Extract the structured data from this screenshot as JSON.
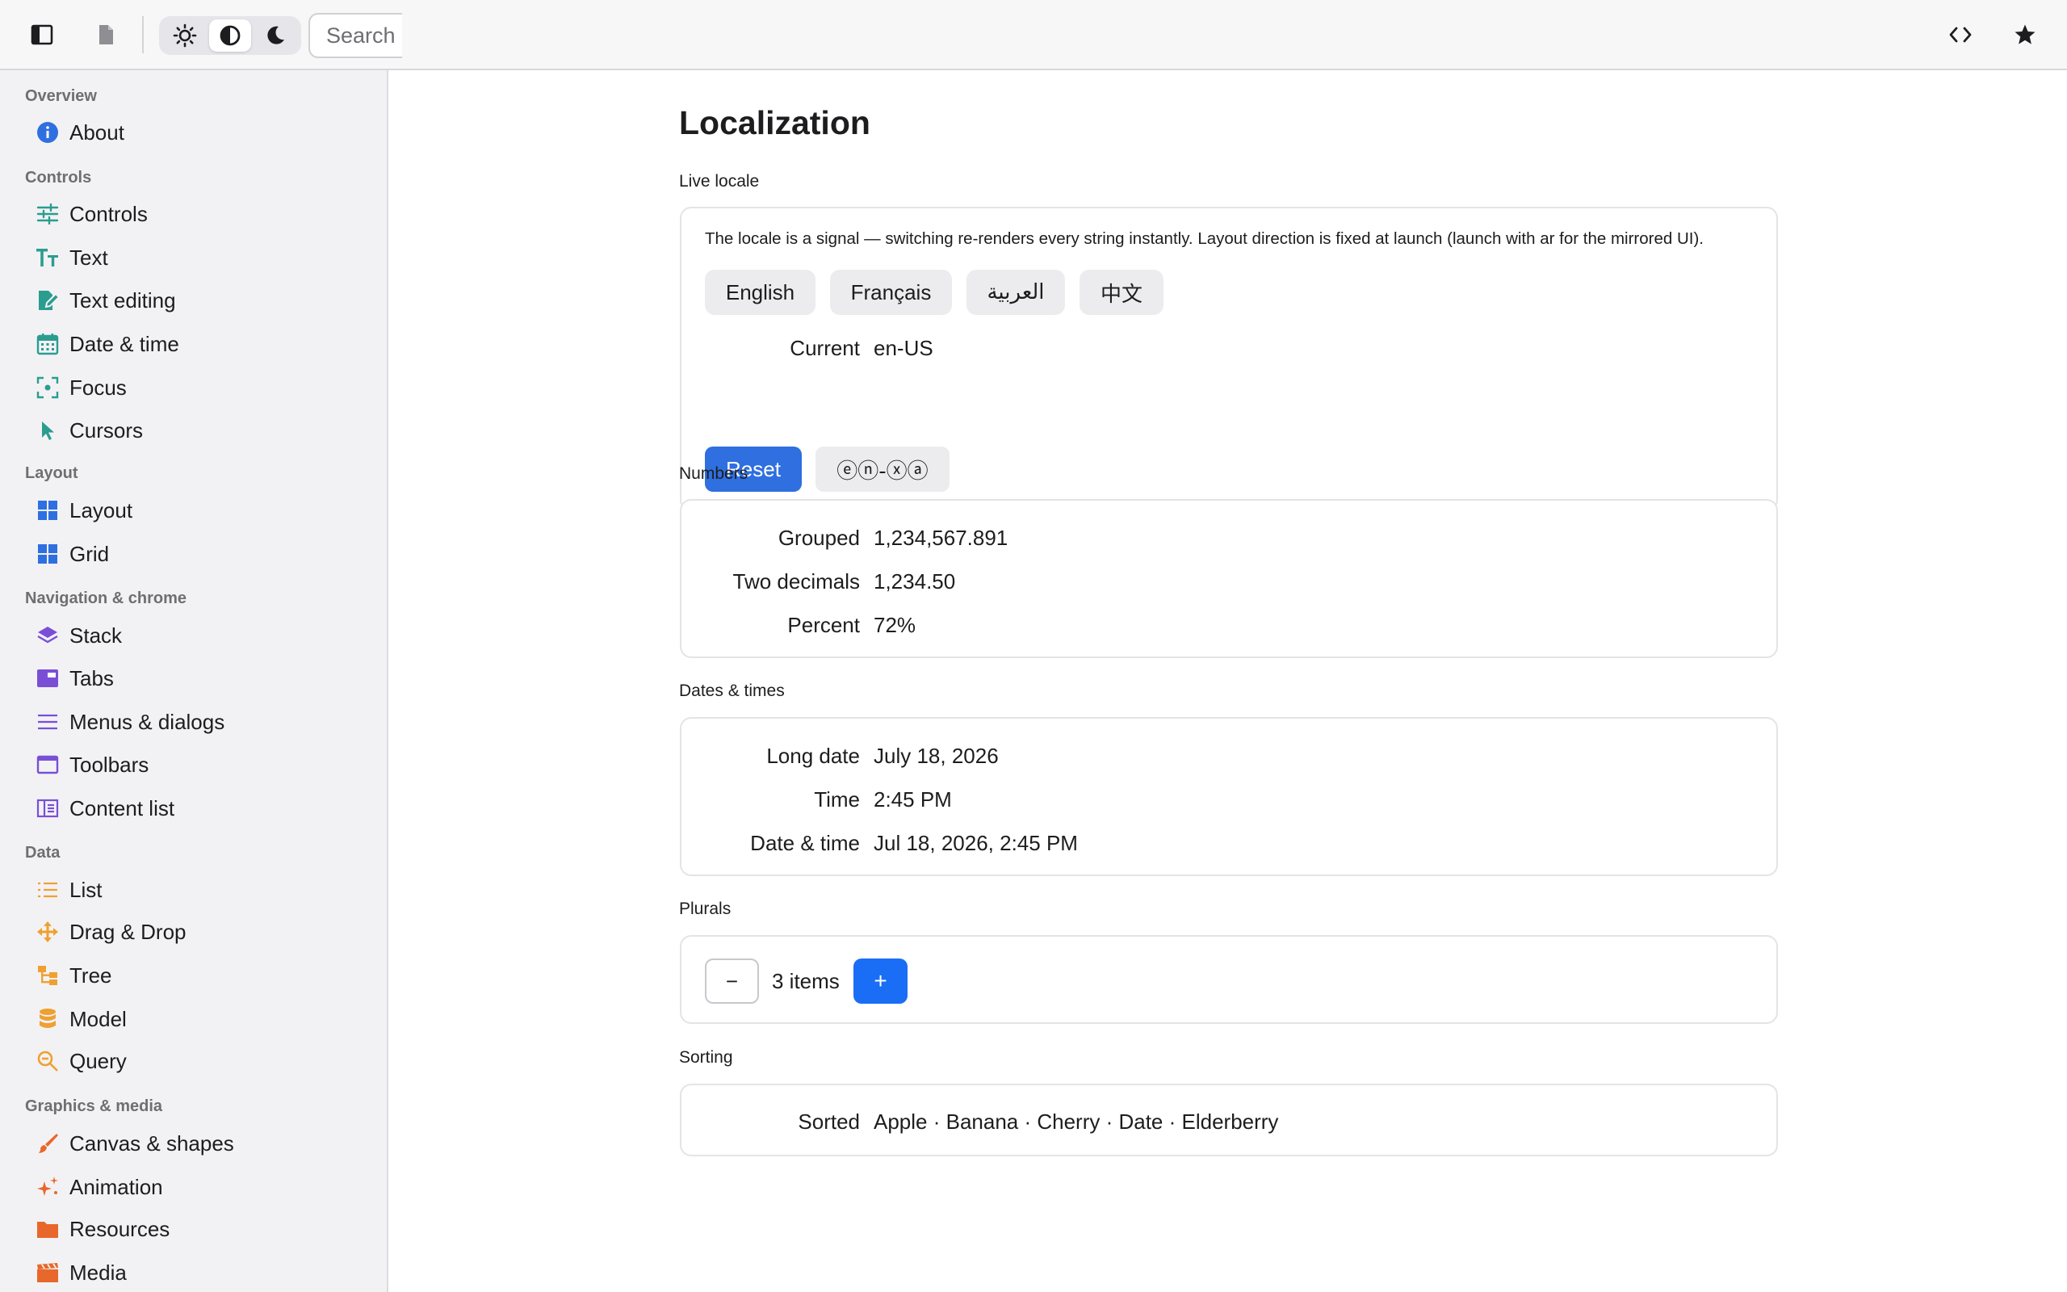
{
  "toolbar": {
    "search_placeholder": "Search",
    "theme_options": [
      "light",
      "auto",
      "dark"
    ],
    "active_theme": "auto"
  },
  "sidebar": {
    "sections": [
      {
        "title": "Overview",
        "items": [
          {
            "label": "About",
            "icon": "info-icon",
            "color": "#2f6fe0"
          }
        ]
      },
      {
        "title": "Controls",
        "items": [
          {
            "label": "Controls",
            "icon": "sliders-icon",
            "color": "#2a9d8f"
          },
          {
            "label": "Text",
            "icon": "text-size-icon",
            "color": "#2a9d8f"
          },
          {
            "label": "Text editing",
            "icon": "edit-document-icon",
            "color": "#2a9d8f"
          },
          {
            "label": "Date & time",
            "icon": "calendar-icon",
            "color": "#2a9d8f"
          },
          {
            "label": "Focus",
            "icon": "focus-target-icon",
            "color": "#2a9d8f"
          },
          {
            "label": "Cursors",
            "icon": "cursor-arrow-icon",
            "color": "#2a9d8f"
          }
        ]
      },
      {
        "title": "Layout",
        "items": [
          {
            "label": "Layout",
            "icon": "layout-grid-icon",
            "color": "#2f6fe0"
          },
          {
            "label": "Grid",
            "icon": "grid-icon",
            "color": "#2f6fe0"
          }
        ]
      },
      {
        "title": "Navigation & chrome",
        "items": [
          {
            "label": "Stack",
            "icon": "layers-icon",
            "color": "#7a4fd6"
          },
          {
            "label": "Tabs",
            "icon": "tabs-icon",
            "color": "#7a4fd6"
          },
          {
            "label": "Menus & dialogs",
            "icon": "menu-lines-icon",
            "color": "#7a4fd6"
          },
          {
            "label": "Toolbars",
            "icon": "window-icon",
            "color": "#7a4fd6"
          },
          {
            "label": "Content list",
            "icon": "content-list-icon",
            "color": "#7a4fd6"
          }
        ]
      },
      {
        "title": "Data",
        "items": [
          {
            "label": "List",
            "icon": "list-icon",
            "color": "#f0a030"
          },
          {
            "label": "Drag & Drop",
            "icon": "move-arrows-icon",
            "color": "#f0a030"
          },
          {
            "label": "Tree",
            "icon": "tree-icon",
            "color": "#f0a030"
          },
          {
            "label": "Model",
            "icon": "database-icon",
            "color": "#f0a030"
          },
          {
            "label": "Query",
            "icon": "magnifier-icon",
            "color": "#f0a030"
          }
        ]
      },
      {
        "title": "Graphics & media",
        "items": [
          {
            "label": "Canvas & shapes",
            "icon": "brush-icon",
            "color": "#e8672a"
          },
          {
            "label": "Animation",
            "icon": "sparkle-icon",
            "color": "#e8672a"
          },
          {
            "label": "Resources",
            "icon": "folder-icon",
            "color": "#e8672a"
          },
          {
            "label": "Media",
            "icon": "clapperboard-icon",
            "color": "#e8672a"
          }
        ]
      }
    ]
  },
  "main": {
    "title": "Localization",
    "live_locale": {
      "label": "Live locale",
      "description": "The locale is a signal — switching re-renders every string instantly. Layout direction is fixed at launch (launch with ar for the mirrored UI).",
      "languages": [
        "English",
        "Français",
        "العربية",
        "中文"
      ],
      "current_label": "Current",
      "current_value": "en-US",
      "reset_label": "Reset",
      "pseudo_label": "ⓔⓝ-ⓧⓐ"
    },
    "numbers": {
      "label": "Numbers",
      "rows": [
        {
          "k": "Grouped",
          "v": "1,234,567.891"
        },
        {
          "k": "Two decimals",
          "v": "1,234.50"
        },
        {
          "k": "Percent",
          "v": "72%"
        }
      ]
    },
    "dates": {
      "label": "Dates & times",
      "rows": [
        {
          "k": "Long date",
          "v": "July 18, 2026"
        },
        {
          "k": "Time",
          "v": "2:45 PM"
        },
        {
          "k": "Date & time",
          "v": "Jul 18, 2026, 2:45 PM"
        }
      ]
    },
    "plurals": {
      "label": "Plurals",
      "minus": "−",
      "count_text": "3 items",
      "plus": "+"
    },
    "sorting": {
      "label": "Sorting",
      "key": "Sorted",
      "value": "Apple · Banana · Cherry · Date · Elderberry"
    }
  }
}
